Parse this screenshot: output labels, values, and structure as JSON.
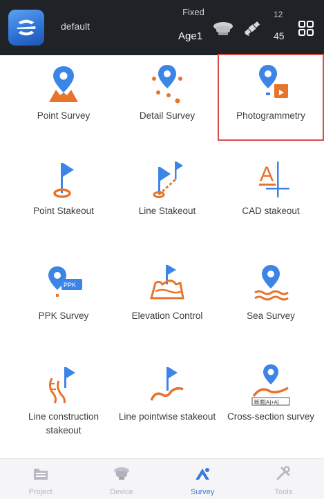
{
  "header": {
    "project_name": "default",
    "solution_status": "Fixed",
    "age_label": "Age1",
    "satellites_used": "12",
    "satellites_visible": "45",
    "icons": [
      "app-logo",
      "rover-icon",
      "satellite-icon",
      "grid-menu-icon"
    ]
  },
  "functions": [
    {
      "label": "Point Survey",
      "icon": "point-survey-icon"
    },
    {
      "label": "Detail Survey",
      "icon": "detail-survey-icon"
    },
    {
      "label": "Photogrammetry",
      "icon": "photogrammetry-icon",
      "selected": true
    },
    {
      "label": "Point Stakeout",
      "icon": "point-stakeout-icon"
    },
    {
      "label": "Line Stakeout",
      "icon": "line-stakeout-icon"
    },
    {
      "label": "CAD stakeout",
      "icon": "cad-stakeout-icon"
    },
    {
      "label": "PPK Survey",
      "icon": "ppk-survey-icon"
    },
    {
      "label": "Elevation Control",
      "icon": "elevation-control-icon"
    },
    {
      "label": "Sea Survey",
      "icon": "sea-survey-icon"
    },
    {
      "label": "Line construction stakeout",
      "icon": "line-construction-stakeout-icon"
    },
    {
      "label": "Line pointwise stakeout",
      "icon": "line-pointwise-stakeout-icon"
    },
    {
      "label": "Cross-section survey",
      "icon": "cross-section-survey-icon"
    }
  ],
  "cross_section_badge": "断面[A]+A]",
  "bottom_nav": [
    {
      "label": "Project",
      "icon": "project-folder-icon"
    },
    {
      "label": "Device",
      "icon": "device-icon"
    },
    {
      "label": "Survey",
      "icon": "survey-icon",
      "active": true
    },
    {
      "label": "Tools",
      "icon": "tools-icon"
    }
  ],
  "colors": {
    "accent_blue": "#3c85e6",
    "accent_orange": "#e8732c",
    "selection_border": "#d94a45",
    "top_bar": "#1f2227"
  }
}
